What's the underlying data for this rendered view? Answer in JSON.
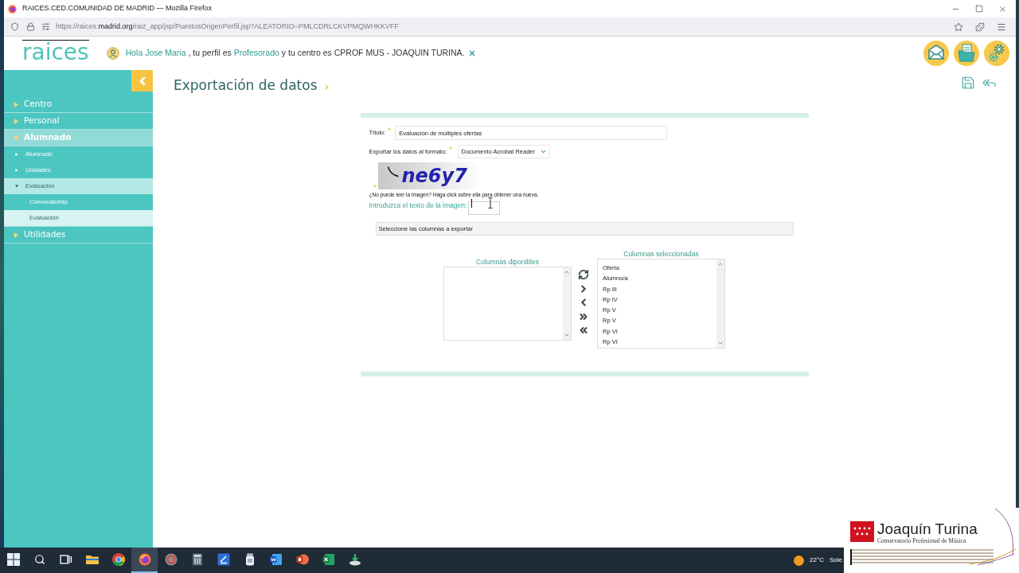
{
  "browser": {
    "title": "RAICES.CED.COMUNIDAD DE MADRID — Mozilla Firefox",
    "url": [
      {
        "text": "https://raices.",
        "highlight": false
      },
      {
        "text": "madrid.org",
        "highlight": true
      },
      {
        "text": "/raiz_app/jsp/PuestosOrigenPerfil.jsp?ALEATORIO=PMLCDRLCKVPMQWHKKVFF",
        "highlight": false
      }
    ]
  },
  "header": {
    "logo": "raices",
    "greeting": [
      {
        "kind": "link",
        "text": "Hola Jose Maria"
      },
      {
        "kind": "text",
        "text": ", tu perfil es"
      },
      {
        "kind": "link",
        "text": "Profesorado"
      },
      {
        "kind": "text",
        "text": "y tu centro es CPROF MUS - JOAQUIN TURINA."
      }
    ]
  },
  "sidebar": {
    "items": [
      {
        "label": "Centro",
        "expanded": false
      },
      {
        "label": "Personal",
        "expanded": false
      },
      {
        "label": "Alumnado",
        "expanded": true,
        "children": [
          {
            "label": "Alumnado",
            "expanded": false
          },
          {
            "label": "Unidades",
            "expanded": false
          },
          {
            "label": "Evaluación",
            "expanded": true,
            "children": [
              {
                "label": "Convocatorias",
                "selected": false
              },
              {
                "label": "Evaluación",
                "selected": true
              }
            ]
          }
        ]
      },
      {
        "label": "Utilidades",
        "expanded": false
      }
    ]
  },
  "main": {
    "title": "Exportación de datos"
  },
  "form": {
    "fields": [
      {
        "kind": "text",
        "label": "Título:",
        "required": true,
        "value": "Evaluación de múltiples ofertas"
      },
      {
        "kind": "select",
        "label": "Exportar los datos al formato:",
        "required": true,
        "value": "Documento Acrobat Reader"
      }
    ],
    "captcha": {
      "required": true,
      "image_text": "ne6y7",
      "hint": "¿No puede leer la imagen? Haga click sobre ella para obtener una nueva.",
      "label": "Introduzca el texto de la imagen:",
      "focused": true,
      "pointer_over": true
    },
    "columns_section": {
      "title": "Seleccione las columnas a exportar"
    },
    "available_columns": {
      "title": "Columnas diponibles"
    },
    "selected_columns": {
      "title": "Columnas seleccionadas",
      "items": [
        {
          "label": "Oferta",
          "selected": false
        },
        {
          "label": "Alumno/a",
          "selected": false
        },
        {
          "label": "Rp III",
          "selected": false
        },
        {
          "label": "Rp IV",
          "selected": false
        },
        {
          "label": "Rp V",
          "selected": false
        },
        {
          "label": "Rp V",
          "selected": false
        },
        {
          "label": "Rp VI",
          "selected": false
        },
        {
          "label": "Rp VI",
          "selected": false
        }
      ]
    }
  },
  "taskbar": {
    "apps": [
      {
        "kind": "start",
        "active": false
      },
      {
        "kind": "search",
        "active": false
      },
      {
        "kind": "task_view",
        "active": false
      },
      {
        "kind": "folder",
        "active": false
      },
      {
        "kind": "chrome",
        "active": false
      },
      {
        "kind": "firefox",
        "active": true
      },
      {
        "kind": "disc",
        "active": false
      },
      {
        "kind": "calculator",
        "active": false
      },
      {
        "kind": "pen_tile",
        "active": false
      },
      {
        "kind": "jar",
        "active": false
      },
      {
        "kind": "word",
        "active": false
      },
      {
        "kind": "powerpoint",
        "active": false
      },
      {
        "kind": "excel",
        "active": false
      },
      {
        "kind": "installer",
        "active": false
      }
    ],
    "weather": {
      "temperature": "22°C",
      "condition": "Sole"
    }
  },
  "overlay": {
    "title": "Joaquín Turina",
    "subtitle": "Conservatorio Profesional de Música"
  }
}
